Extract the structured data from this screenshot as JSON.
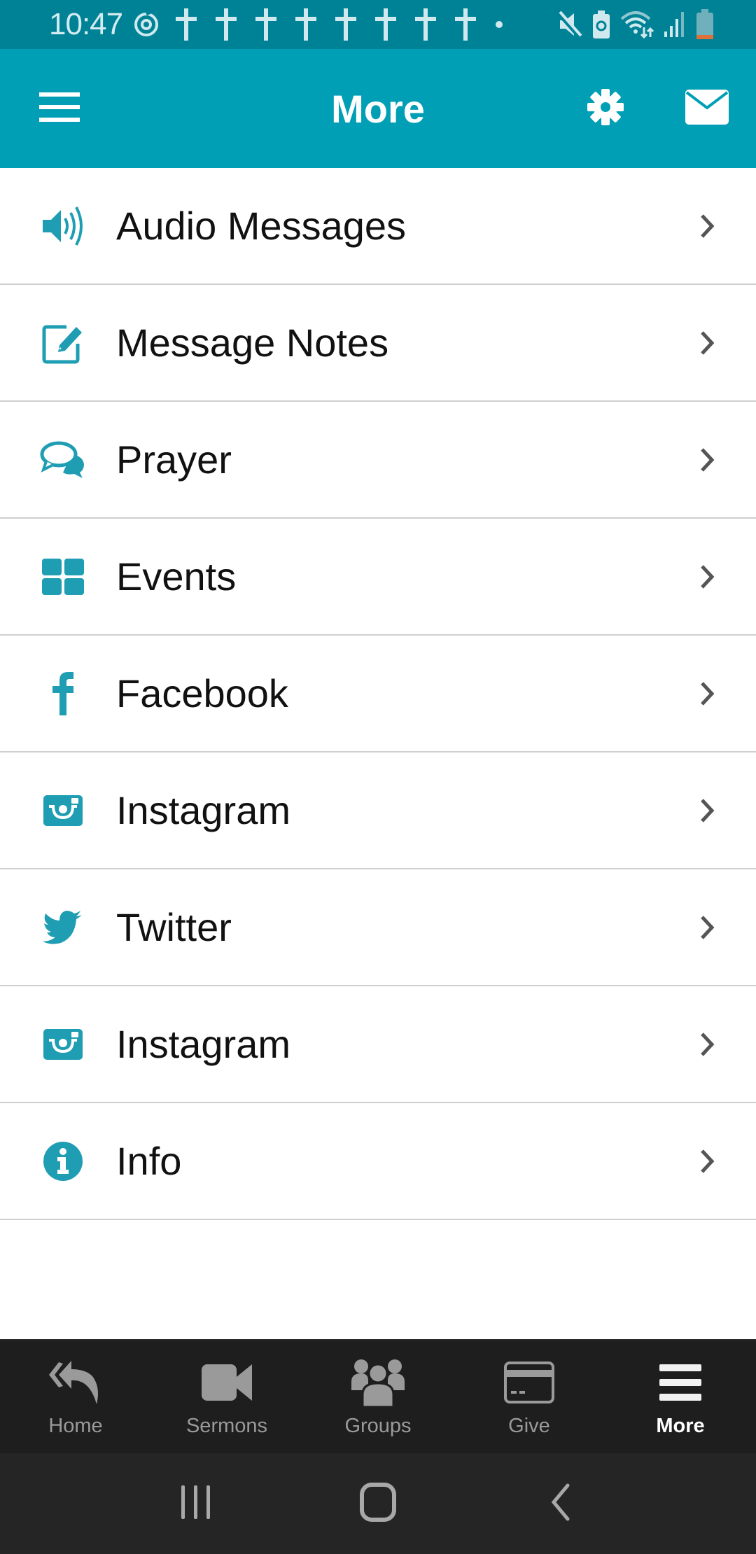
{
  "status_bar": {
    "time": "10:47",
    "notification_icons": [
      "sync-icon",
      "cross-icon",
      "cross-icon",
      "cross-icon",
      "cross-icon",
      "cross-icon",
      "cross-icon",
      "cross-icon",
      "cross-icon",
      "dot-icon"
    ],
    "system_icons": [
      "mute-icon",
      "battery-saver-icon",
      "wifi-icon",
      "signal-icon",
      "battery-icon"
    ],
    "battery_level": 0.15
  },
  "app_bar": {
    "title": "More",
    "left_icon": "hamburger-menu-icon",
    "right_icons": [
      "gear-icon",
      "mail-icon"
    ]
  },
  "menu": {
    "items": [
      {
        "label": "Audio Messages",
        "icon": "speaker-icon"
      },
      {
        "label": "Message Notes",
        "icon": "edit-note-icon"
      },
      {
        "label": "Prayer",
        "icon": "chat-bubbles-icon"
      },
      {
        "label": "Events",
        "icon": "grid-icon"
      },
      {
        "label": "Facebook",
        "icon": "facebook-icon"
      },
      {
        "label": "Instagram",
        "icon": "instagram-icon"
      },
      {
        "label": "Twitter",
        "icon": "twitter-icon"
      },
      {
        "label": "Instagram",
        "icon": "instagram-icon"
      },
      {
        "label": "Info",
        "icon": "info-icon"
      }
    ]
  },
  "tab_bar": {
    "tabs": [
      {
        "label": "Home",
        "icon": "reply-all-icon",
        "active": false
      },
      {
        "label": "Sermons",
        "icon": "video-camera-icon",
        "active": false
      },
      {
        "label": "Groups",
        "icon": "users-icon",
        "active": false
      },
      {
        "label": "Give",
        "icon": "credit-card-icon",
        "active": false
      },
      {
        "label": "More",
        "icon": "menu-icon",
        "active": true
      }
    ]
  },
  "nav_bar": {
    "buttons": [
      "recents-icon",
      "home-icon",
      "back-icon"
    ]
  },
  "colors": {
    "status_bar": "#008296",
    "accent": "#009fb5",
    "icon_teal": "#1e9db3",
    "tab_bar": "#1e1e1e",
    "nav_bar": "#252525"
  }
}
